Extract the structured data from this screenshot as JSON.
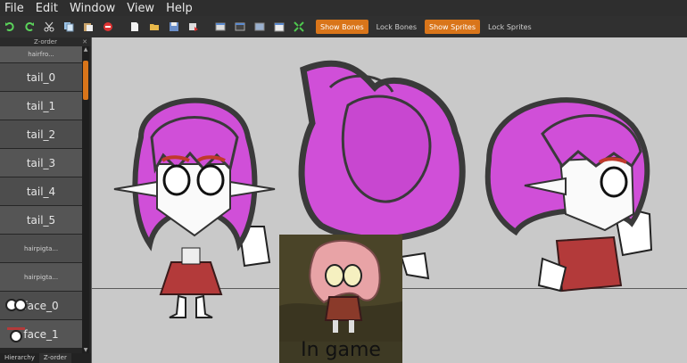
{
  "menu": [
    "File",
    "Edit",
    "Window",
    "View",
    "Help"
  ],
  "toolbar": {
    "show_bones": "Show Bones",
    "lock_bones": "Lock Bones",
    "show_sprites": "Show Sprites",
    "lock_sprites": "Lock Sprites",
    "active_color": "#d9751a"
  },
  "panel": {
    "title": "Z-order",
    "close": "✕",
    "items": [
      "hairfro...",
      "tail_0",
      "tail_1",
      "tail_2",
      "tail_3",
      "tail_4",
      "tail_5",
      "hairpigta...",
      "hairpigta...",
      "face_0",
      "face_1"
    ],
    "tabs": [
      "Hierarchy",
      "Z-order"
    ]
  },
  "inset": {
    "label": "In game"
  },
  "colors": {
    "hair": "#d04fd8",
    "hair_outline": "#3a3a3a",
    "dress": "#b33a3a",
    "canvas": "#c9c9c9"
  }
}
